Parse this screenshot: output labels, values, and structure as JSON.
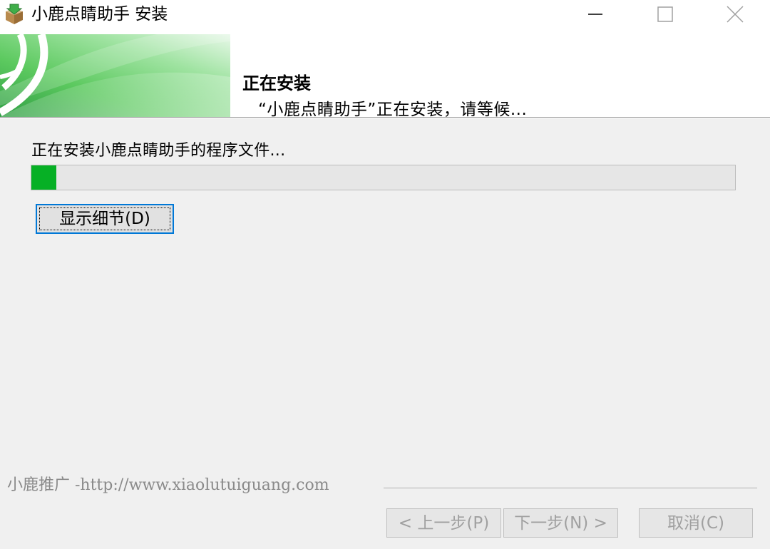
{
  "window": {
    "title": "小鹿点睛助手 安装",
    "icon": "package-install-icon",
    "controls": [
      "minimize-icon",
      "maximize-icon",
      "close-icon"
    ]
  },
  "header": {
    "title": "正在安装",
    "subtitle": "“小鹿点睛助手”正在安装，请等候..."
  },
  "body": {
    "status_text": "正在安装小鹿点睛助手的程序文件...",
    "progress_fraction": 0.035,
    "show_details_label": "显示细节(D)"
  },
  "footer": {
    "branding": "小鹿推广 -http://www.xiaolutuiguang.com",
    "back_label": "< 上一步(P)",
    "next_label": "下一步(N) >",
    "cancel_label": "取消(C)"
  },
  "colors": {
    "progress_fill": "#06b025",
    "focus_border": "#0078d7",
    "banner_green": "#5cc95f"
  }
}
